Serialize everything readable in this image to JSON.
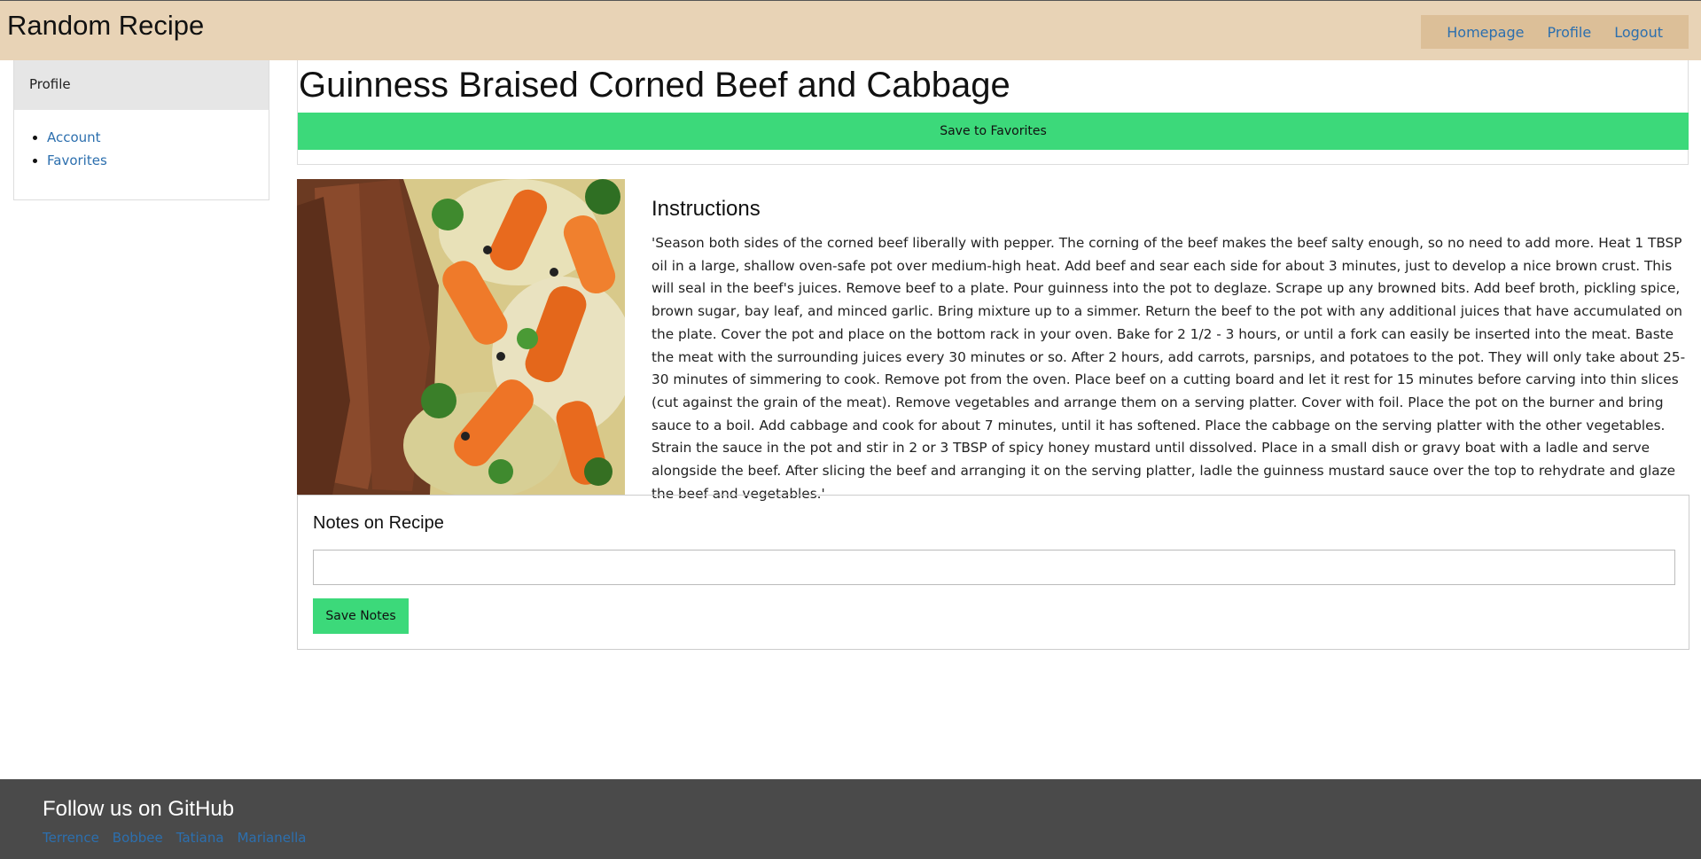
{
  "header": {
    "brand": "Random Recipe",
    "nav": [
      {
        "label": "Homepage"
      },
      {
        "label": "Profile"
      },
      {
        "label": "Logout"
      }
    ]
  },
  "sidebar": {
    "heading": "Profile",
    "items": [
      {
        "label": "Account"
      },
      {
        "label": "Favorites"
      }
    ]
  },
  "recipe": {
    "title": "Guinness Braised Corned Beef and Cabbage",
    "save_favorites_label": "Save to Favorites",
    "instructions_heading": "Instructions",
    "instructions_text": "'Season both sides of the corned beef liberally with pepper. The corning of the beef makes the beef salty enough, so no need to add more. Heat 1 TBSP oil in a large, shallow oven-safe pot over medium-high heat. Add beef and sear each side for about 3 minutes, just to develop a nice brown crust. This will seal in the beef's juices. Remove beef to a plate. Pour guinness into the pot to deglaze. Scrape up any browned bits. Add beef broth, pickling spice, brown sugar, bay leaf, and minced garlic. Bring mixture up to a simmer. Return the beef to the pot with any additional juices that have accumulated on the plate. Cover the pot and place on the bottom rack in your oven. Bake for 2 1/2 - 3 hours, or until a fork can easily be inserted into the meat. Baste the meat with the surrounding juices every 30 minutes or so. After 2 hours, add carrots, parsnips, and potatoes to the pot. They will only take about 25-30 minutes of simmering to cook. Remove pot from the oven. Place beef on a cutting board and let it rest for 15 minutes before carving into thin slices (cut against the grain of the meat). Remove vegetables and arrange them on a serving platter. Cover with foil. Place the pot on the burner and bring sauce to a boil. Add cabbage and cook for about 7 minutes, until it has softened. Place the cabbage on the serving platter with the other vegetables. Strain the sauce in the pot and stir in 2 or 3 TBSP of spicy honey mustard until dissolved. Place in a small dish or gravy boat with a ladle and serve alongside the beef. After slicing the beef and arranging it on the serving platter, ladle the guinness mustard sauce over the top to rehydrate and glaze the beef and vegetables.'"
  },
  "notes": {
    "heading": "Notes on Recipe",
    "input_value": "",
    "placeholder": "",
    "save_label": "Save Notes"
  },
  "footer": {
    "heading": "Follow us on GitHub",
    "links": [
      {
        "label": "Terrence"
      },
      {
        "label": "Bobbee"
      },
      {
        "label": "Tatiana"
      },
      {
        "label": "Marianella"
      }
    ]
  },
  "colors": {
    "header_bg": "#e8d3b6",
    "nav_bg": "#dcbf98",
    "accent_green": "#3cd97a",
    "link_blue": "#2c6fae",
    "footer_bg": "#4a4a4a"
  }
}
